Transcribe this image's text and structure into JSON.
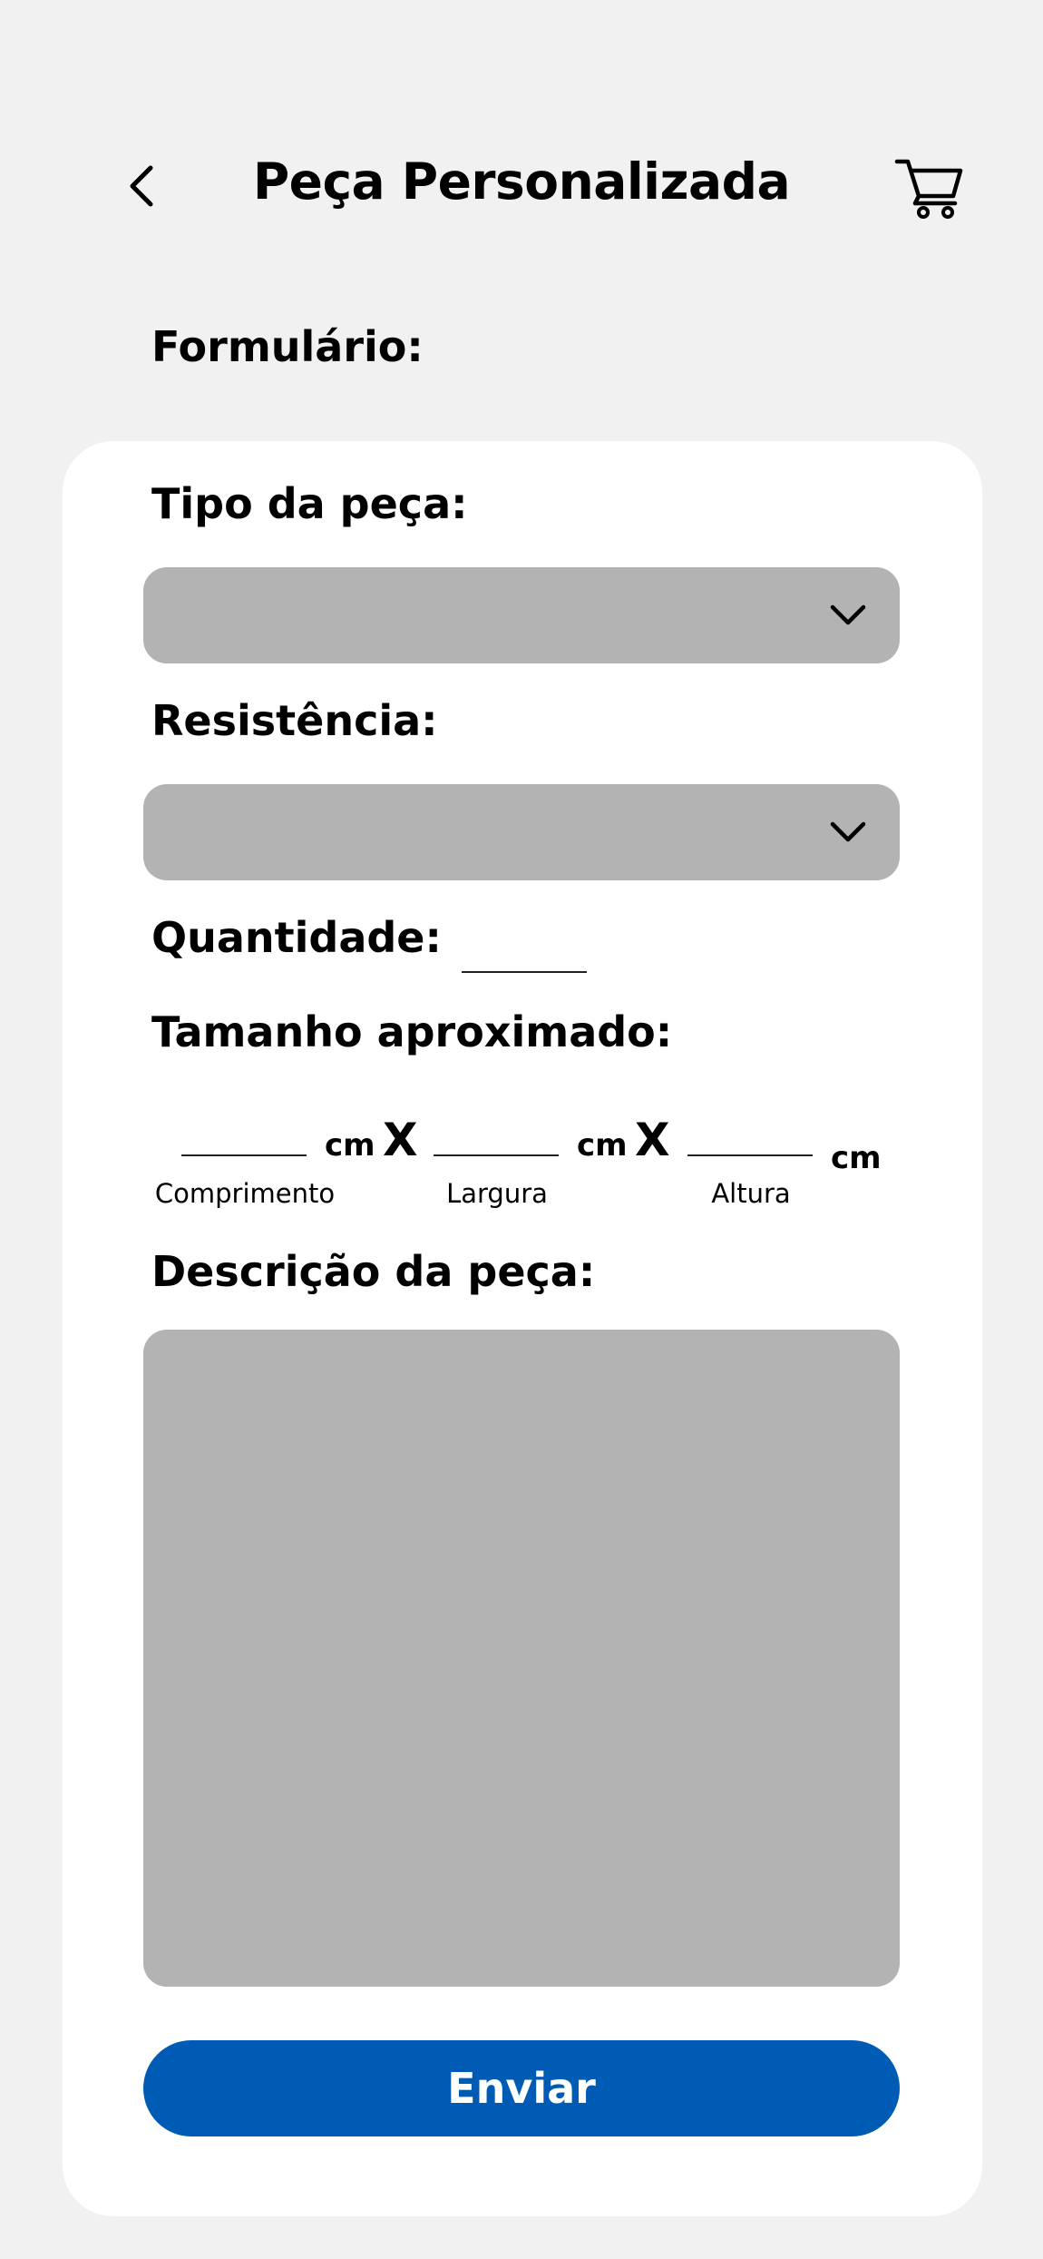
{
  "header": {
    "title": "Peça Personalizada",
    "back_icon": "chevron-left-icon",
    "cart_icon": "shopping-cart-icon"
  },
  "form": {
    "heading": "Formulário:",
    "piece_type": {
      "label": "Tipo da peça:",
      "value": ""
    },
    "resistance": {
      "label": "Resistência:",
      "value": ""
    },
    "quantity": {
      "label": "Quantidade:",
      "value": ""
    },
    "size": {
      "label": "Tamanho aproximado:",
      "unit": "cm",
      "times": "X",
      "length_caption": "Comprimento",
      "width_caption": "Largura",
      "height_caption": "Altura"
    },
    "description": {
      "label": "Descrição da peça:",
      "value": ""
    },
    "submit_label": "Enviar"
  },
  "colors": {
    "background": "#f1f1f1",
    "card": "#ffffff",
    "field": "#b3b3b3",
    "primary": "#005bb4"
  }
}
